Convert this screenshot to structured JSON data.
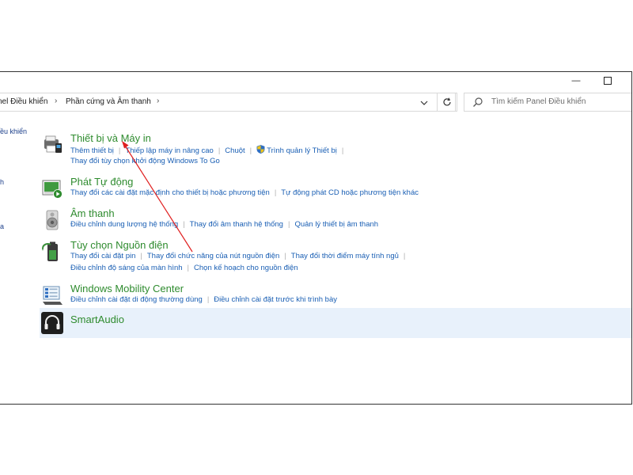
{
  "window": {
    "min_glyph": "—",
    "max_glyph": "☐"
  },
  "addressbar": {
    "crumb1": "nel Điều khiển",
    "crumb2": "Phần cứng và Âm thanh",
    "sep": "›",
    "dropdown_icon": "chevron-down-icon",
    "refresh_icon": "refresh-icon"
  },
  "search": {
    "placeholder": "Tìm kiếm Panel Điều khiển"
  },
  "left_nav": {
    "frag1": "ều khiển",
    "frag2": "h",
    "frag3": "a"
  },
  "categories": [
    {
      "title": "Thiết bị và Máy in",
      "icon": "printer-icon",
      "rows": [
        [
          "Thêm thiết bị",
          "Thiếp lập máy in nâng cao",
          "Chuột",
          "Trình quản lý Thiết bị"
        ],
        [
          "Thay đổi tùy chọn khởi động Windows To Go"
        ]
      ]
    },
    {
      "title": "Phát Tự động",
      "icon": "autoplay-icon",
      "rows": [
        [
          "Thay đổi các cài đặt mặc định cho thiết bị hoặc phương tiện",
          "Tự động phát CD hoặc phương tiện khác"
        ]
      ]
    },
    {
      "title": "Âm thanh",
      "icon": "speaker-icon",
      "rows": [
        [
          "Điều chỉnh dung lượng hệ thống",
          "Thay đổi âm thanh hệ thống",
          "Quản lý thiết bị âm thanh"
        ]
      ]
    },
    {
      "title": "Tùy chọn Nguồn điện",
      "icon": "battery-icon",
      "rows": [
        [
          "Thay đổi cài đặt pin",
          "Thay đổi chức năng của nút nguồn điện",
          "Thay đổi thời điểm máy tính ngủ"
        ],
        [
          "Điều chỉnh độ sáng của màn hình",
          "Chọn kế hoạch cho nguồn điện"
        ]
      ]
    },
    {
      "title": "Windows Mobility Center",
      "icon": "mobility-center-icon",
      "rows": [
        [
          "Điều chỉnh cài đặt di động thường dùng",
          "Điều chỉnh cài đặt trước khi trình bày"
        ]
      ]
    },
    {
      "title": "SmartAudio",
      "icon": "headphones-icon",
      "rows": []
    }
  ],
  "annotation": {
    "type": "red-arrow",
    "color": "#e02020",
    "points_to": "Thiết bị và Máy in"
  }
}
